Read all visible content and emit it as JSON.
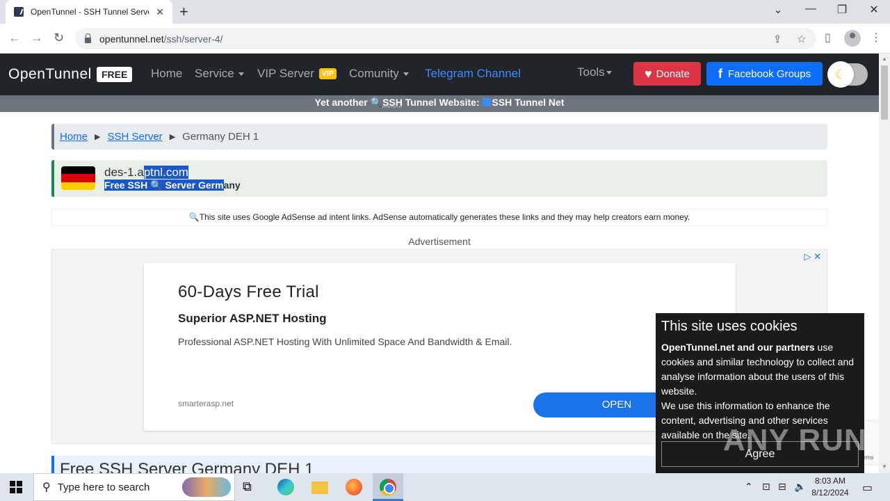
{
  "browser": {
    "tab_title": "OpenTunnel - SSH Tunnel Server",
    "tab_close": "✕",
    "new_tab": "+",
    "url_host": "opentunnel.net",
    "url_path": "/ssh/server-4/",
    "window_controls": [
      "⌄",
      "—",
      "❐",
      "✕"
    ]
  },
  "nav": {
    "brand": "OpenTunnel",
    "brand_badge": "FREE",
    "home": "Home",
    "service": "Service",
    "vip_server": "VIP Server",
    "vip_badge": "VIP",
    "comunity": "Comunity",
    "telegram": "Telegram Channel",
    "tools": "Tools",
    "donate": "Donate",
    "facebook": "Facebook Groups"
  },
  "announce": {
    "prefix": "Yet another ",
    "ssh": "SSH",
    "middle": " Tunnel Website: ",
    "site": "SSH Tunnel Net"
  },
  "breadcrumb": {
    "home": "Home",
    "ssh_server": "SSH Server",
    "current": "Germany DEH 1"
  },
  "server": {
    "host_a": "des-1.a",
    "host_b": "ptnl.com",
    "sub_a": "Free SSH ",
    "sub_b": " Server Germ",
    "sub_c": "any"
  },
  "adsense_notice": "This site uses Google AdSense ad intent links. AdSense automatically generates these links and they may help creators earn money.",
  "ad": {
    "label": "Advertisement",
    "title": "60-Days Free Trial",
    "subtitle": "Superior ASP.NET Hosting",
    "description": "Professional ASP.NET Hosting With Unlimited Space And Bandwidth & Email.",
    "domain": "smarterasp.net",
    "cta": "OPEN"
  },
  "section_title": "Free SSH Server Germany DEH 1",
  "cookie": {
    "title": "This site uses cookies",
    "bold": "OpenTunnel.net and our partners",
    "text1": " use cookies and similar technology to collect and analyse information about the users of this website.",
    "text2": "We use this information to enhance the content, advertising and other services available on the site.",
    "agree": "Agree"
  },
  "watermark": "ANY RUN",
  "recaptcha_text": "rms",
  "taskbar": {
    "search_placeholder": "Type here to search",
    "time": "8:03 AM",
    "date": "8/12/2024"
  },
  "colors": {
    "navbar": "#212529",
    "donate": "#dc3545",
    "facebook": "#0d6efd",
    "flag": [
      "#000000",
      "#dd0000",
      "#ffce00"
    ]
  }
}
